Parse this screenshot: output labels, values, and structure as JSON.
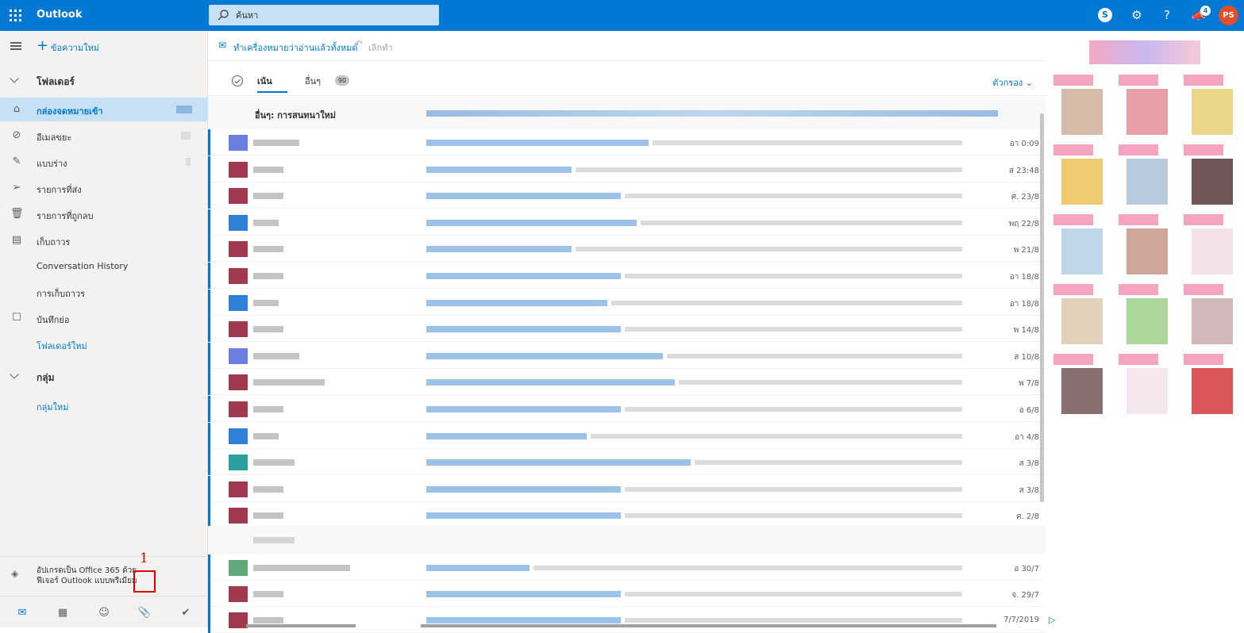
{
  "topbar": {
    "app_name": "Outlook",
    "search_placeholder": "ค้นหา",
    "notifications_count": "4",
    "avatar_initials": "PS",
    "accent": "#0078d4"
  },
  "leftnav": {
    "new_message": "ข้อความใหม่",
    "folders_header": "โฟลเดอร์",
    "items": [
      {
        "label": "กล่องจดหมายเข้า",
        "icon": "inbox-icon",
        "selected": true
      },
      {
        "label": "อีเมลขยะ",
        "icon": "junk-icon"
      },
      {
        "label": "แบบร่าง",
        "icon": "pencil-icon"
      },
      {
        "label": "รายการที่ส่ง",
        "icon": "send-icon"
      },
      {
        "label": "รายการที่ถูกลบ",
        "icon": "trash-icon"
      },
      {
        "label": "เก็บถาวร",
        "icon": "archive-icon"
      },
      {
        "label": "Conversation History"
      },
      {
        "label": "การเก็บถาวร"
      },
      {
        "label": "บันทึกย่อ",
        "icon": "note-icon"
      },
      {
        "label": "โฟลเดอร์ใหม่",
        "link": true
      }
    ],
    "groups_header": "กลุ่ม",
    "new_group": "กลุ่มใหม่",
    "upgrade_line1": "อัปเกรดเป็น Office 365 ด้วย",
    "upgrade_line2": "ฟีเจอร์ Outlook แบบพรีเมียม",
    "annotation_number": "1"
  },
  "commandbar": {
    "mark_all_read": "ทำเครื่องหมายว่าอ่านแล้วทั้งหมด",
    "undo": "เลิกทำ"
  },
  "list": {
    "tab_focused": "เน้น",
    "tab_other": "อื่นๆ",
    "other_count": "90",
    "filter": "ตัวกรอง",
    "other_header": "อื่นๆ: การสนทนาใหม่",
    "dates": [
      "อา 0:09",
      "ส 23:48",
      "ศ. 23/8",
      "พฤ 22/8",
      "พ 21/8",
      "อา 18/8",
      "อา 18/8",
      "พ 14/8",
      "ส 10/8",
      "พ 7/8",
      "อ 6/8",
      "อา 4/8",
      "ส 3/8",
      "ส 3/8",
      "ศ. 2/8"
    ],
    "dates2": [
      "อ 30/7",
      "จ. 29/7",
      "7/7/2019"
    ]
  }
}
